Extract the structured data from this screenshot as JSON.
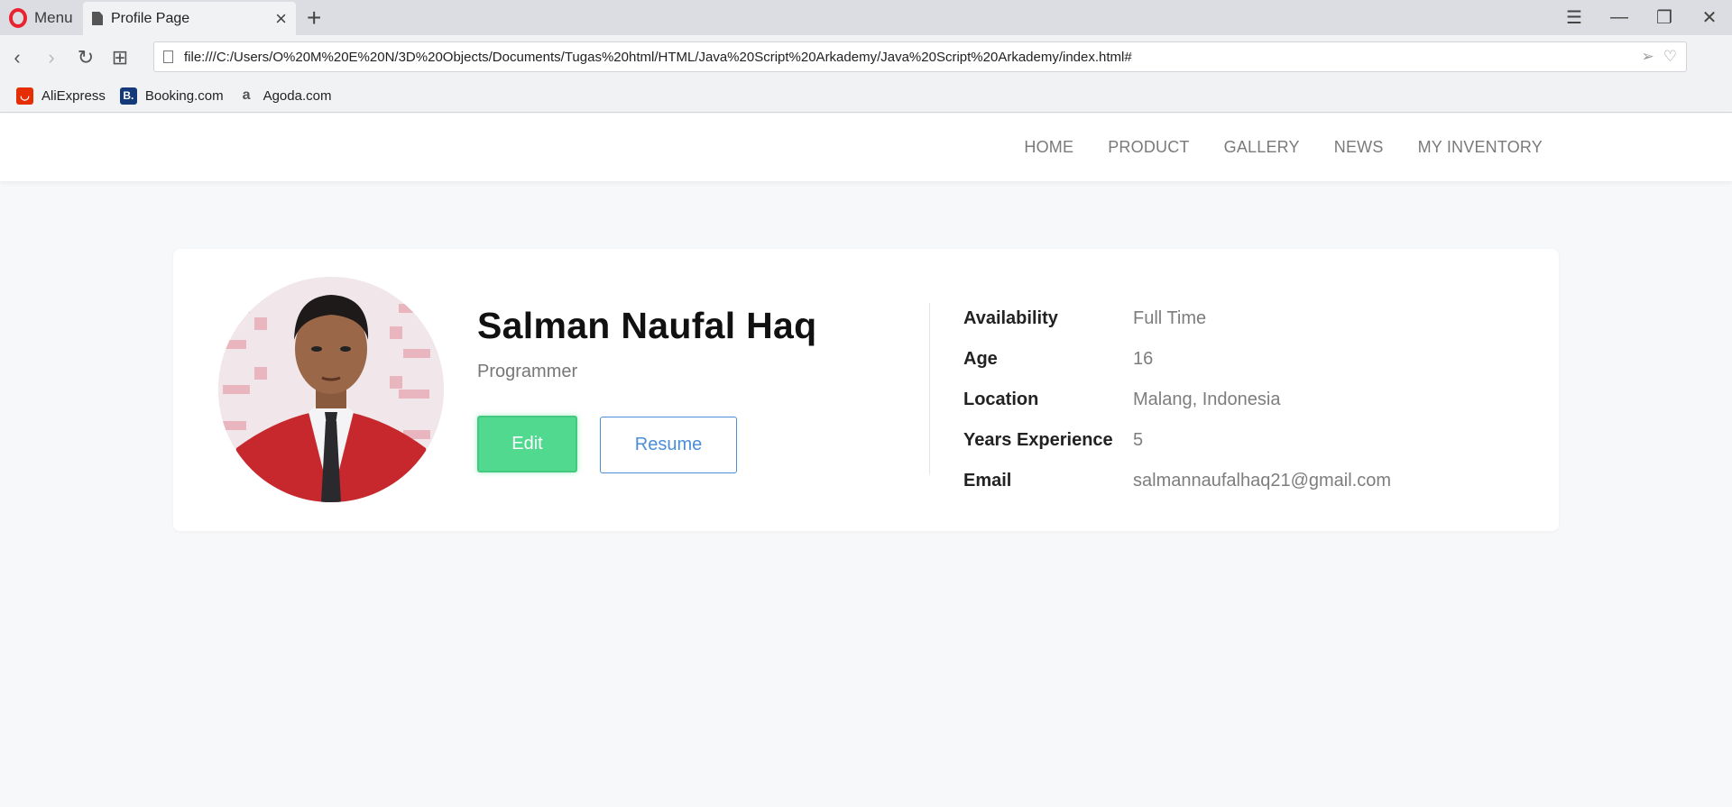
{
  "browser": {
    "menu_label": "Menu",
    "tab_title": "Profile Page",
    "url": "file:///C:/Users/O%20M%20E%20N/3D%20Objects/Documents/Tugas%20html/HTML/Java%20Script%20Arkademy/Java%20Script%20Arkademy/index.html#",
    "bookmarks": [
      {
        "label": "AliExpress",
        "icon": "aliexpress-icon"
      },
      {
        "label": "Booking.com",
        "icon": "booking-icon"
      },
      {
        "label": "Agoda.com",
        "icon": "agoda-icon"
      }
    ]
  },
  "nav": {
    "items": [
      "HOME",
      "PRODUCT",
      "GALLERY",
      "NEWS",
      "MY INVENTORY"
    ]
  },
  "profile": {
    "name": "Salman Naufal Haq",
    "role": "Programmer",
    "edit_label": "Edit",
    "resume_label": "Resume",
    "details": [
      {
        "label": "Availability",
        "value": "Full Time"
      },
      {
        "label": "Age",
        "value": "16"
      },
      {
        "label": "Location",
        "value": "Malang, Indonesia"
      },
      {
        "label": "Years Experience",
        "value": "5"
      },
      {
        "label": "Email",
        "value": "salmannaufalhaq21@gmail.com"
      }
    ]
  },
  "colors": {
    "edit_button": "#52d990",
    "resume_button": "#4b8ed8",
    "page_background": "#f7f8fa"
  }
}
